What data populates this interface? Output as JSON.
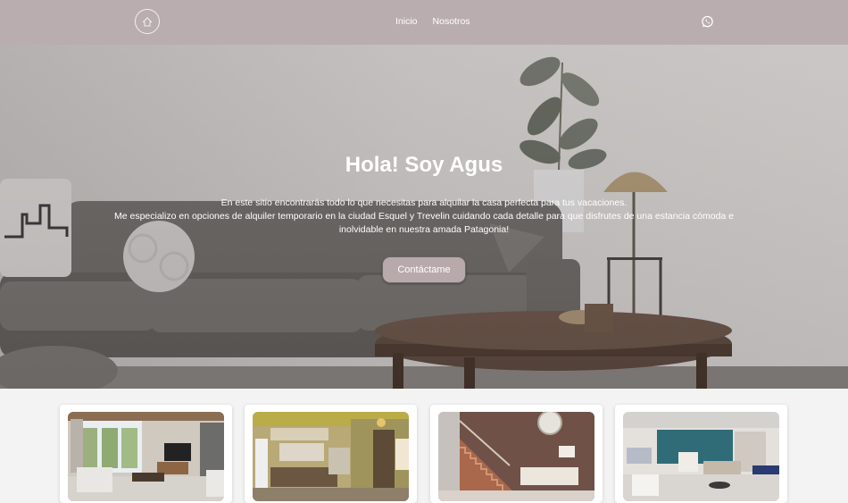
{
  "nav": {
    "logo_icon": "house-circle-icon",
    "links": [
      {
        "label": "Inicio"
      },
      {
        "label": "Nosotros"
      }
    ],
    "whatsapp_icon": "whatsapp-icon"
  },
  "hero": {
    "title": "Hola! Soy Agus",
    "line1": "En este sitio encontrarás todo lo que necesitas para alquilar la casa perfecta para tus vacaciones.",
    "line2": "Me especializo en opciones de alquiler temporario en la ciudad Esquel y Trevelin cuidando cada detalle para que disfrutes de una estancia cómoda e",
    "line3": "inolvidable en nuestra amada Patagonia!",
    "cta_label": "Contáctame"
  },
  "colors": {
    "navbar": "#b9adaf",
    "button": "#b8a9ab",
    "page_bg": "#f3f3f3"
  },
  "cards": [
    {
      "photo": "living-room-photo"
    },
    {
      "photo": "kitchen-photo"
    },
    {
      "photo": "stairs-photo"
    },
    {
      "photo": "bedroom-photo"
    }
  ]
}
